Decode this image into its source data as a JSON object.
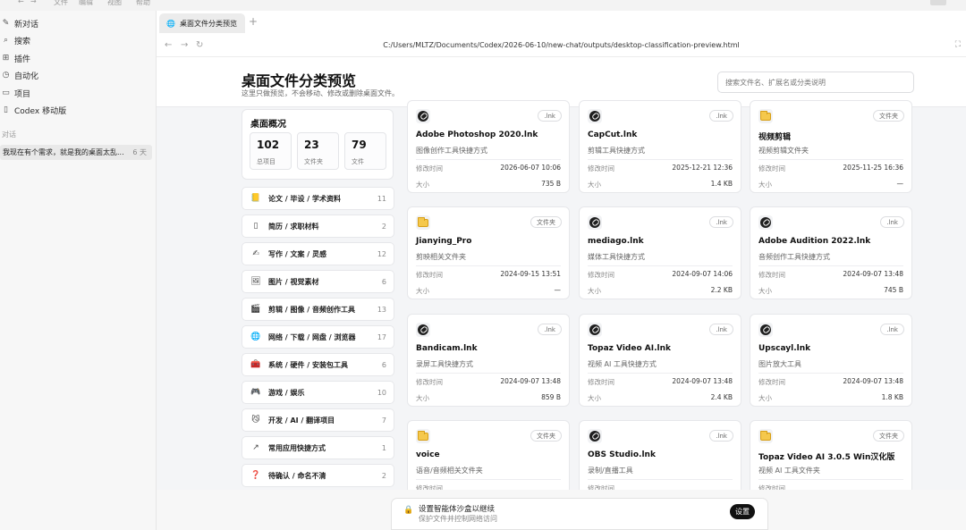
{
  "menu": [
    "文件",
    "编辑",
    "视图",
    "帮助"
  ],
  "sidebar": {
    "items": [
      {
        "label": "新对话",
        "icon": "edit-icon"
      },
      {
        "label": "搜索",
        "icon": "search-icon"
      },
      {
        "label": "插件",
        "icon": "plugin-icon"
      },
      {
        "label": "自动化",
        "icon": "clock-icon"
      },
      {
        "label": "项目",
        "icon": "folder-icon"
      },
      {
        "label": "Codex 移动版",
        "icon": "phone-icon"
      }
    ],
    "section_label": "对话",
    "chat": {
      "title": "我现在有个需求，就是我的桌面太乱...",
      "age": "6 天"
    }
  },
  "browser": {
    "tab_title": "桌面文件分类预览",
    "url": "C:/Users/MLTZ/Documents/Codex/2026-06-10/new-chat/outputs/desktop-classification-preview.html"
  },
  "page": {
    "title": "桌面文件分类预览",
    "subtitle": "这里只做预览，不会移动、修改或删除桌面文件。",
    "search_placeholder": "搜索文件名、扩展名或分类说明",
    "overview": {
      "title": "桌面概况",
      "stats": [
        {
          "value": "102",
          "label": "总项目"
        },
        {
          "value": "23",
          "label": "文件夹"
        },
        {
          "value": "79",
          "label": "文件"
        }
      ]
    },
    "categories": [
      {
        "icon": "📒",
        "name": "论文 / 毕设 / 学术资料",
        "count": "11"
      },
      {
        "icon": "▯",
        "name": "简历 / 求职材料",
        "count": "2"
      },
      {
        "icon": "✍",
        "name": "写作 / 文案 / 灵感",
        "count": "12"
      },
      {
        "icon": "🖼",
        "name": "图片 / 视觉素材",
        "count": "6"
      },
      {
        "icon": "🎬",
        "name": "剪辑 / 图像 / 音频创作工具",
        "count": "13"
      },
      {
        "icon": "🌐",
        "name": "网络 / 下载 / 网盘 / 浏览器",
        "count": "17"
      },
      {
        "icon": "🧰",
        "name": "系统 / 硬件 / 安装包工具",
        "count": "6"
      },
      {
        "icon": "🎮",
        "name": "游戏 / 娱乐",
        "count": "10"
      },
      {
        "icon": "😼",
        "name": "开发 / AI / 翻译项目",
        "count": "7"
      },
      {
        "icon": "↗",
        "name": "常用应用快捷方式",
        "count": "1"
      },
      {
        "icon": "❓",
        "name": "待确认 / 命名不清",
        "count": "2"
      }
    ],
    "labels": {
      "mtime": "修改时间",
      "size": "大小"
    },
    "cards": [
      {
        "type": "lnk",
        "badge": ".lnk",
        "name": "Adobe Photoshop 2020.lnk",
        "desc": "图像创作工具快捷方式",
        "mtime": "2026-06-07 10:06",
        "size": "735 B"
      },
      {
        "type": "lnk",
        "badge": ".lnk",
        "name": "CapCut.lnk",
        "desc": "剪辑工具快捷方式",
        "mtime": "2025-12-21 12:36",
        "size": "1.4 KB"
      },
      {
        "type": "folder",
        "badge": "文件夹",
        "name": "视频剪辑",
        "desc": "视频剪辑文件夹",
        "mtime": "2025-11-25 16:36",
        "size": "—"
      },
      {
        "type": "folder",
        "badge": "文件夹",
        "name": "Jianying_Pro",
        "desc": "剪映相关文件夹",
        "mtime": "2024-09-15 13:51",
        "size": "—"
      },
      {
        "type": "lnk",
        "badge": ".lnk",
        "name": "mediago.lnk",
        "desc": "媒体工具快捷方式",
        "mtime": "2024-09-07 14:06",
        "size": "2.2 KB"
      },
      {
        "type": "lnk",
        "badge": ".lnk",
        "name": "Adobe Audition 2022.lnk",
        "desc": "音频创作工具快捷方式",
        "mtime": "2024-09-07 13:48",
        "size": "745 B"
      },
      {
        "type": "lnk",
        "badge": ".lnk",
        "name": "Bandicam.lnk",
        "desc": "录屏工具快捷方式",
        "mtime": "2024-09-07 13:48",
        "size": "859 B"
      },
      {
        "type": "lnk",
        "badge": ".lnk",
        "name": "Topaz Video AI.lnk",
        "desc": "视频 AI 工具快捷方式",
        "mtime": "2024-09-07 13:48",
        "size": "2.4 KB"
      },
      {
        "type": "lnk",
        "badge": ".lnk",
        "name": "Upscayl.lnk",
        "desc": "图片放大工具",
        "mtime": "2024-09-07 13:48",
        "size": "1.8 KB"
      },
      {
        "type": "folder",
        "badge": "文件夹",
        "name": "voice",
        "desc": "语音/音频相关文件夹",
        "mtime": "",
        "size": ""
      },
      {
        "type": "lnk",
        "badge": ".lnk",
        "name": "OBS Studio.lnk",
        "desc": "录制/直播工具",
        "mtime": "",
        "size": ""
      },
      {
        "type": "folder",
        "badge": "文件夹",
        "name": "Topaz Video AI 3.0.5 Win汉化版",
        "desc": "视频 AI 工具文件夹",
        "mtime": "",
        "size": ""
      }
    ]
  },
  "notice": {
    "title": "设置智能体沙盒以继续",
    "subtitle": "保护文件并控制网络访问",
    "button": "设置"
  }
}
